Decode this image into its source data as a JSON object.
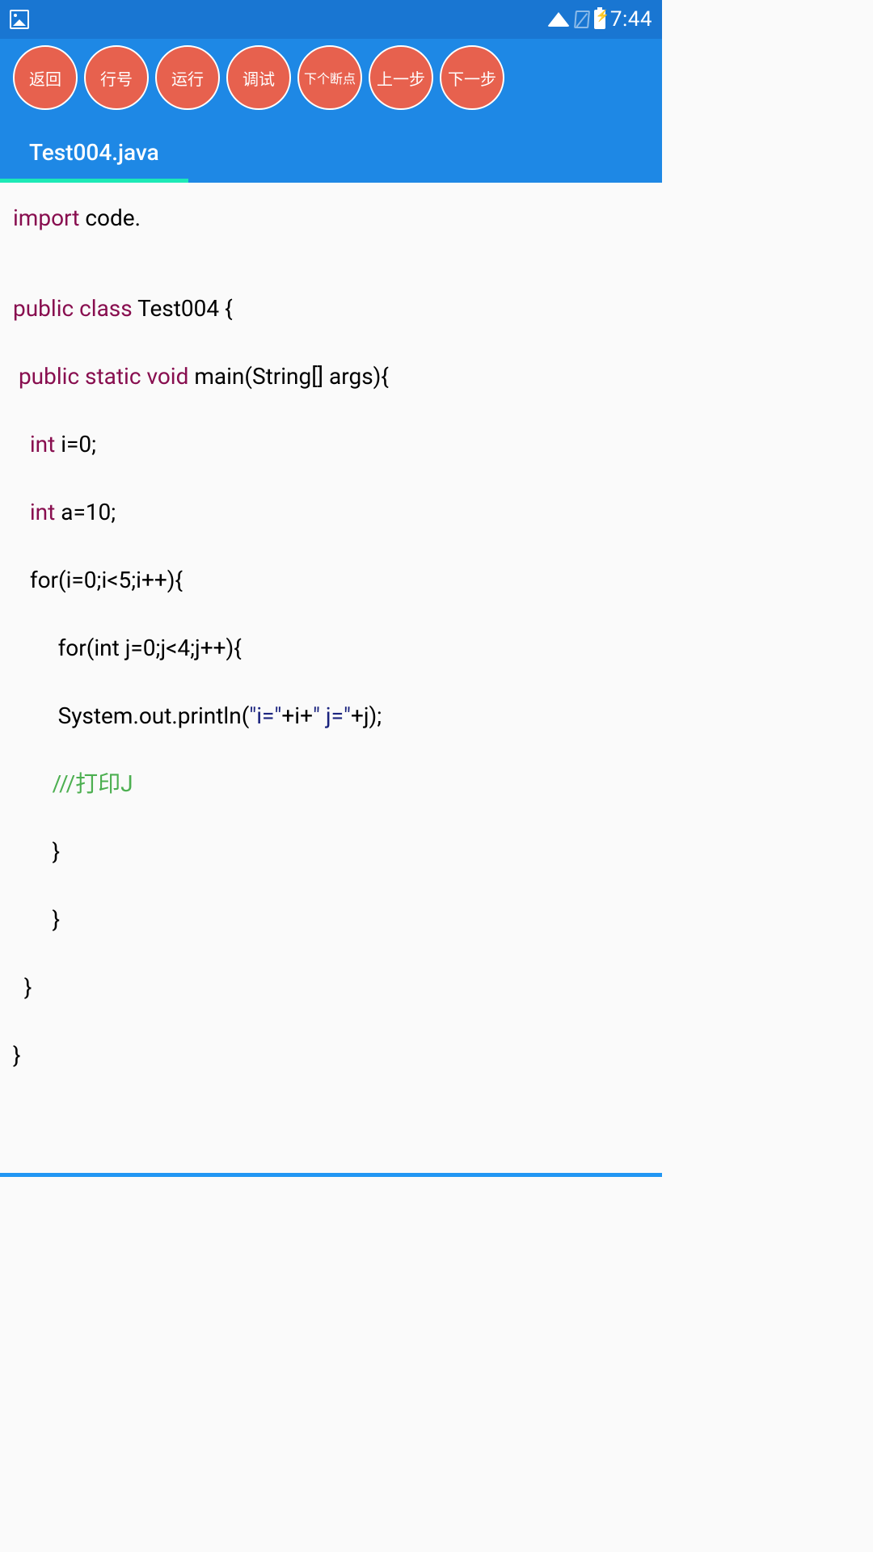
{
  "statusbar": {
    "time": "7:44"
  },
  "toolbar": {
    "buttons": [
      {
        "label": "返回"
      },
      {
        "label": "行号"
      },
      {
        "label": "运行"
      },
      {
        "label": "调试"
      },
      {
        "label": "下个断点"
      },
      {
        "label": "上一步"
      },
      {
        "label": "下一步"
      }
    ]
  },
  "tabs": {
    "active": "Test004.java"
  },
  "code": {
    "lines": [
      {
        "segments": [
          {
            "t": "kw",
            "v": "import"
          },
          {
            "t": "plain",
            "v": " code."
          }
        ]
      },
      {
        "segments": []
      },
      {
        "segments": []
      },
      {
        "segments": [
          {
            "t": "kw",
            "v": "public class"
          },
          {
            "t": "plain",
            "v": " Test004 {"
          }
        ]
      },
      {
        "segments": []
      },
      {
        "segments": [
          {
            "t": "plain",
            "v": " "
          },
          {
            "t": "kw",
            "v": "public static void"
          },
          {
            "t": "plain",
            "v": " main(String[] args){"
          }
        ]
      },
      {
        "segments": []
      },
      {
        "segments": [
          {
            "t": "plain",
            "v": "   "
          },
          {
            "t": "kw",
            "v": "int"
          },
          {
            "t": "plain",
            "v": " i=0;"
          }
        ]
      },
      {
        "segments": []
      },
      {
        "segments": [
          {
            "t": "plain",
            "v": "   "
          },
          {
            "t": "kw",
            "v": "int"
          },
          {
            "t": "plain",
            "v": " a=10;"
          }
        ]
      },
      {
        "segments": []
      },
      {
        "segments": [
          {
            "t": "plain",
            "v": "   for(i=0;i<5;i++){"
          }
        ]
      },
      {
        "segments": []
      },
      {
        "segments": [
          {
            "t": "plain",
            "v": "        for(int j=0;j<4;j++){"
          }
        ]
      },
      {
        "segments": []
      },
      {
        "segments": [
          {
            "t": "plain",
            "v": "        System.out.println("
          },
          {
            "t": "str",
            "v": "\"i=\""
          },
          {
            "t": "plain",
            "v": "+i+"
          },
          {
            "t": "str",
            "v": "\" j=\""
          },
          {
            "t": "plain",
            "v": "+j);"
          }
        ]
      },
      {
        "segments": []
      },
      {
        "segments": [
          {
            "t": "plain",
            "v": "       "
          },
          {
            "t": "cmt",
            "v": "///打印J"
          }
        ]
      },
      {
        "segments": []
      },
      {
        "segments": [
          {
            "t": "plain",
            "v": "       }"
          }
        ]
      },
      {
        "segments": []
      },
      {
        "segments": [
          {
            "t": "plain",
            "v": "       }"
          }
        ]
      },
      {
        "segments": []
      },
      {
        "segments": [
          {
            "t": "plain",
            "v": "  }"
          }
        ]
      },
      {
        "segments": []
      },
      {
        "segments": [
          {
            "t": "plain",
            "v": "}"
          }
        ]
      }
    ]
  }
}
